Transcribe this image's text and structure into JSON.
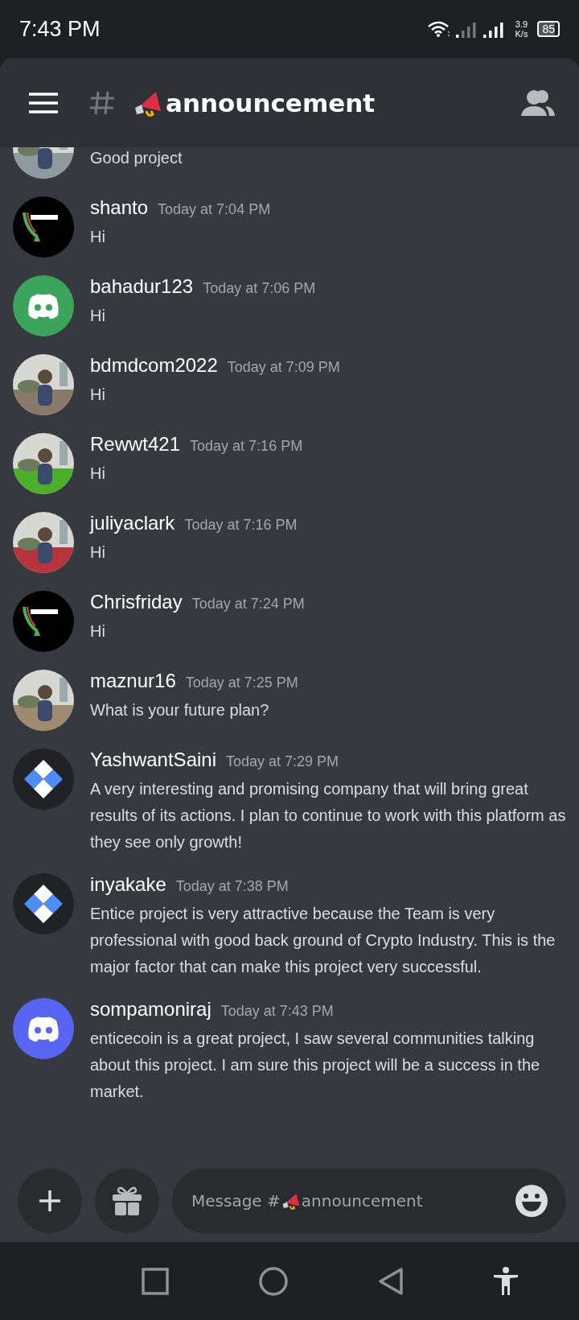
{
  "status_bar": {
    "time": "7:43 PM",
    "speed_value": "3.9",
    "speed_unit": "K/s",
    "battery": "85"
  },
  "header": {
    "channel": "announcement"
  },
  "messages": [
    {
      "body": "Good project"
    },
    {
      "author": "shanto",
      "time": "Today at 7:04 PM",
      "avatar": {
        "kind": "trophy",
        "color": "#000000"
      },
      "body": "Hi"
    },
    {
      "author": "bahadur123",
      "time": "Today at 7:06 PM",
      "avatar": {
        "kind": "discord",
        "color": "#3ba55c"
      },
      "body": "Hi"
    },
    {
      "author": "bdmdcom2022",
      "time": "Today at 7:09 PM",
      "body": "Hi"
    },
    {
      "author": "Rewwt421",
      "time": "Today at 7:16 PM",
      "body": "Hi"
    },
    {
      "author": "juliyaclark",
      "time": "Today at 7:16 PM",
      "body": "Hi"
    },
    {
      "author": "Chrisfriday",
      "time": "Today at 7:24 PM",
      "avatar": {
        "kind": "trophy",
        "color": "#000000"
      },
      "body": "Hi"
    },
    {
      "author": "maznur16",
      "time": "Today at 7:25 PM",
      "body": "What is your future plan?"
    },
    {
      "author": "YashwantSaini",
      "time": "Today at 7:29 PM",
      "avatar": {
        "kind": "diamond",
        "color": "#202225"
      },
      "body": "A very interesting and promising company that will bring great results of its actions. I plan to continue to work with this platform as they see only growth!"
    },
    {
      "author": "inyakake",
      "time": "Today at 7:38 PM",
      "avatar": {
        "kind": "diamond",
        "color": "#202225"
      },
      "body": "Entice project is very attractive because the Team is very professional with good back ground of Crypto Industry. This is the major factor that can make this project very successful."
    },
    {
      "author": "sompamoniraj",
      "time": "Today at 7:43 PM",
      "avatar": {
        "kind": "discord",
        "color": "#5865f2"
      },
      "body": "enticecoin is a great project, I saw several communities talking about this project. I am sure this project will be a success in the market."
    }
  ],
  "composer": {
    "placeholder_prefix": "Message #",
    "placeholder_channel": "announcement"
  }
}
